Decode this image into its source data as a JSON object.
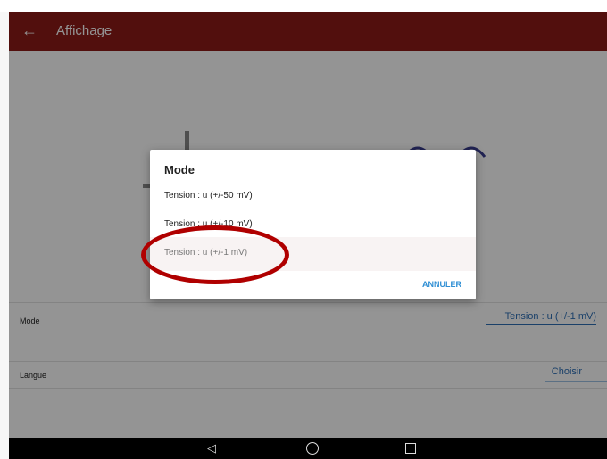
{
  "appbar": {
    "title": "Affichage",
    "back_icon": "arrow-left-icon"
  },
  "settings": {
    "mode": {
      "label": "Mode",
      "value": "Tension : u (+/-1 mV)"
    },
    "langue": {
      "label": "Langue",
      "value": "Choisir"
    }
  },
  "dialog": {
    "title": "Mode",
    "options": [
      "Tension : u (+/-50 mV)",
      "Tension : u (+/-10 mV)",
      "Tension : u (+/-1 mV)"
    ],
    "cancel_label": "ANNULER"
  },
  "navbar": {
    "back_icon": "triangle-back-icon",
    "home_icon": "circle-home-icon",
    "recents_icon": "square-recents-icon"
  },
  "colors": {
    "appbar": "#8d1a17",
    "accent": "#2f8fd4",
    "highlight": "#b00000"
  }
}
